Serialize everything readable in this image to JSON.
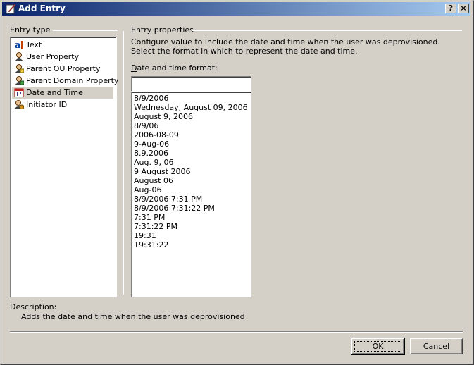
{
  "window": {
    "title": "Add Entry",
    "help_glyph": "?",
    "close_glyph": "×"
  },
  "entry_type": {
    "group_label": "Entry type",
    "items": [
      {
        "label": "Text",
        "icon": "text-icon",
        "selected": false
      },
      {
        "label": "User Property",
        "icon": "user-property-icon",
        "selected": false
      },
      {
        "label": "Parent OU Property",
        "icon": "parent-ou-icon",
        "selected": false
      },
      {
        "label": "Parent Domain Property",
        "icon": "parent-domain-icon",
        "selected": false
      },
      {
        "label": "Date and Time",
        "icon": "calendar-icon",
        "selected": true
      },
      {
        "label": "Initiator ID",
        "icon": "initiator-icon",
        "selected": false
      }
    ]
  },
  "entry_properties": {
    "group_label": "Entry properties",
    "description": "Configure value to include the date and time when the user was deprovisioned. Select the format in which to represent the date and time.",
    "format_label_prefix": "D",
    "format_label_rest": "ate and time format:",
    "format_input_value": "",
    "formats": [
      "8/9/2006",
      "Wednesday, August 09, 2006",
      "August 9, 2006",
      "8/9/06",
      "2006-08-09",
      "9-Aug-06",
      "8.9.2006",
      "Aug. 9, 06",
      "9 August 2006",
      "August 06",
      "Aug-06",
      "8/9/2006 7:31 PM",
      "8/9/2006 7:31:22 PM",
      "7:31 PM",
      "7:31:22 PM",
      "19:31",
      "19:31:22"
    ]
  },
  "description": {
    "label": "Description:",
    "value": "Adds the date and time when the user was deprovisioned"
  },
  "buttons": {
    "ok": "OK",
    "cancel": "Cancel"
  }
}
